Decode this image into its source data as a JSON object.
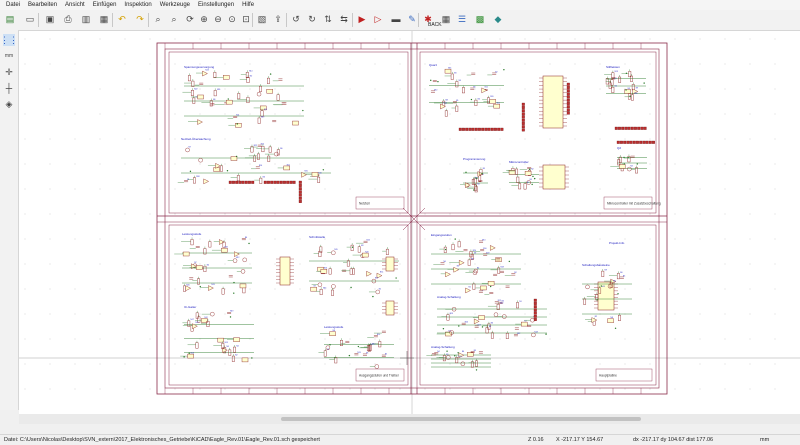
{
  "menu": [
    "Datei",
    "Bearbeiten",
    "Ansicht",
    "Einfügen",
    "Inspektion",
    "Werkzeuge",
    "Einstellungen",
    "Hilfe"
  ],
  "toolbar": {
    "icons": [
      "new-sheet-icon",
      "open-icon",
      "save-icon",
      "print-icon",
      "plot-icon",
      "paste-icon",
      "undo-icon",
      "redo-icon",
      "find-icon",
      "find-replace-icon",
      "refresh-icon",
      "zoom-in-icon",
      "zoom-out-icon",
      "zoom-fit-icon",
      "zoom-selection-icon",
      "hierarchy-icon",
      "leave-sheet-icon",
      "rotate-ccw-icon",
      "rotate-cw-icon",
      "mirror-v-icon",
      "mirror-h-icon",
      "symbol-editor-icon",
      "symbol-browser-icon",
      "netlist-icon",
      "annotate-icon",
      "erc-icon",
      "footprint-assign-icon",
      "bom-icon",
      "pcb-icon",
      "python-icon"
    ],
    "back_label": "BACK"
  },
  "left_tools": [
    "grid-icon",
    "units-icon",
    "cursor-icon",
    "hidden-pins-icon",
    "wire-angle-icon"
  ],
  "sheet": {
    "border_color": "#8a2a4a",
    "wire_color": "#2a7a2a",
    "body_color": "#ffffcf",
    "symbol_color": "#8a2020",
    "label_color": "#2020c0"
  },
  "quadrants": {
    "tl": {
      "title": "Netzteil",
      "blocks": [
        "Spannungsversorgung",
        "Netzteil-Überwachung"
      ]
    },
    "tr": {
      "title": "Mikrocontroller mit Zusatzbeschaltung",
      "blocks": [
        "Quarz",
        "Mikrocontroller",
        "Stiftleisten",
        "Programmierung"
      ]
    },
    "bl": {
      "title": "Ausgangsstufen und Treiber",
      "blocks": [
        "Leistungsstufe",
        "Schnittstelle",
        "IC-Gatter"
      ]
    },
    "br": {
      "title": "Hauptplatine",
      "blocks": [
        "Eingangsstufen",
        "Analog-Schaltung",
        "Schaltungsbausteine",
        "Projekt-Info"
      ]
    }
  },
  "status": {
    "file": "Datei: C:\\Users\\Nicolas\\Desktop\\SVN_extern\\2017_Elektronisches_Getriebe\\KiCAD\\Eagle_Rev.01\\Eagle_Rev.01.sch gespeichert",
    "zoom": "Z 0.16",
    "coords": "X -217.17  Y 154.67",
    "delta": "dx -217.17  dy 104.67  dist 177.06",
    "units": "mm"
  }
}
